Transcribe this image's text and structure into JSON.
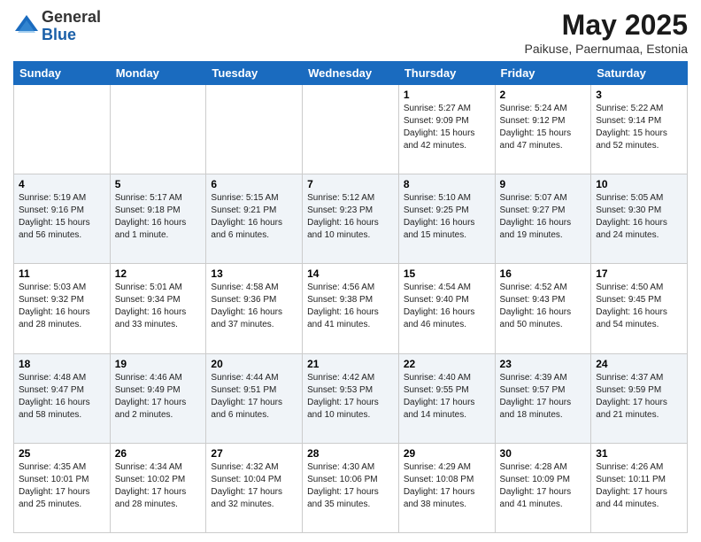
{
  "logo": {
    "general": "General",
    "blue": "Blue"
  },
  "title": "May 2025",
  "subtitle": "Paikuse, Paernumaa, Estonia",
  "days_header": [
    "Sunday",
    "Monday",
    "Tuesday",
    "Wednesday",
    "Thursday",
    "Friday",
    "Saturday"
  ],
  "weeks": [
    [
      {
        "day": "",
        "info": ""
      },
      {
        "day": "",
        "info": ""
      },
      {
        "day": "",
        "info": ""
      },
      {
        "day": "",
        "info": ""
      },
      {
        "day": "1",
        "info": "Sunrise: 5:27 AM\nSunset: 9:09 PM\nDaylight: 15 hours\nand 42 minutes."
      },
      {
        "day": "2",
        "info": "Sunrise: 5:24 AM\nSunset: 9:12 PM\nDaylight: 15 hours\nand 47 minutes."
      },
      {
        "day": "3",
        "info": "Sunrise: 5:22 AM\nSunset: 9:14 PM\nDaylight: 15 hours\nand 52 minutes."
      }
    ],
    [
      {
        "day": "4",
        "info": "Sunrise: 5:19 AM\nSunset: 9:16 PM\nDaylight: 15 hours\nand 56 minutes."
      },
      {
        "day": "5",
        "info": "Sunrise: 5:17 AM\nSunset: 9:18 PM\nDaylight: 16 hours\nand 1 minute."
      },
      {
        "day": "6",
        "info": "Sunrise: 5:15 AM\nSunset: 9:21 PM\nDaylight: 16 hours\nand 6 minutes."
      },
      {
        "day": "7",
        "info": "Sunrise: 5:12 AM\nSunset: 9:23 PM\nDaylight: 16 hours\nand 10 minutes."
      },
      {
        "day": "8",
        "info": "Sunrise: 5:10 AM\nSunset: 9:25 PM\nDaylight: 16 hours\nand 15 minutes."
      },
      {
        "day": "9",
        "info": "Sunrise: 5:07 AM\nSunset: 9:27 PM\nDaylight: 16 hours\nand 19 minutes."
      },
      {
        "day": "10",
        "info": "Sunrise: 5:05 AM\nSunset: 9:30 PM\nDaylight: 16 hours\nand 24 minutes."
      }
    ],
    [
      {
        "day": "11",
        "info": "Sunrise: 5:03 AM\nSunset: 9:32 PM\nDaylight: 16 hours\nand 28 minutes."
      },
      {
        "day": "12",
        "info": "Sunrise: 5:01 AM\nSunset: 9:34 PM\nDaylight: 16 hours\nand 33 minutes."
      },
      {
        "day": "13",
        "info": "Sunrise: 4:58 AM\nSunset: 9:36 PM\nDaylight: 16 hours\nand 37 minutes."
      },
      {
        "day": "14",
        "info": "Sunrise: 4:56 AM\nSunset: 9:38 PM\nDaylight: 16 hours\nand 41 minutes."
      },
      {
        "day": "15",
        "info": "Sunrise: 4:54 AM\nSunset: 9:40 PM\nDaylight: 16 hours\nand 46 minutes."
      },
      {
        "day": "16",
        "info": "Sunrise: 4:52 AM\nSunset: 9:43 PM\nDaylight: 16 hours\nand 50 minutes."
      },
      {
        "day": "17",
        "info": "Sunrise: 4:50 AM\nSunset: 9:45 PM\nDaylight: 16 hours\nand 54 minutes."
      }
    ],
    [
      {
        "day": "18",
        "info": "Sunrise: 4:48 AM\nSunset: 9:47 PM\nDaylight: 16 hours\nand 58 minutes."
      },
      {
        "day": "19",
        "info": "Sunrise: 4:46 AM\nSunset: 9:49 PM\nDaylight: 17 hours\nand 2 minutes."
      },
      {
        "day": "20",
        "info": "Sunrise: 4:44 AM\nSunset: 9:51 PM\nDaylight: 17 hours\nand 6 minutes."
      },
      {
        "day": "21",
        "info": "Sunrise: 4:42 AM\nSunset: 9:53 PM\nDaylight: 17 hours\nand 10 minutes."
      },
      {
        "day": "22",
        "info": "Sunrise: 4:40 AM\nSunset: 9:55 PM\nDaylight: 17 hours\nand 14 minutes."
      },
      {
        "day": "23",
        "info": "Sunrise: 4:39 AM\nSunset: 9:57 PM\nDaylight: 17 hours\nand 18 minutes."
      },
      {
        "day": "24",
        "info": "Sunrise: 4:37 AM\nSunset: 9:59 PM\nDaylight: 17 hours\nand 21 minutes."
      }
    ],
    [
      {
        "day": "25",
        "info": "Sunrise: 4:35 AM\nSunset: 10:01 PM\nDaylight: 17 hours\nand 25 minutes."
      },
      {
        "day": "26",
        "info": "Sunrise: 4:34 AM\nSunset: 10:02 PM\nDaylight: 17 hours\nand 28 minutes."
      },
      {
        "day": "27",
        "info": "Sunrise: 4:32 AM\nSunset: 10:04 PM\nDaylight: 17 hours\nand 32 minutes."
      },
      {
        "day": "28",
        "info": "Sunrise: 4:30 AM\nSunset: 10:06 PM\nDaylight: 17 hours\nand 35 minutes."
      },
      {
        "day": "29",
        "info": "Sunrise: 4:29 AM\nSunset: 10:08 PM\nDaylight: 17 hours\nand 38 minutes."
      },
      {
        "day": "30",
        "info": "Sunrise: 4:28 AM\nSunset: 10:09 PM\nDaylight: 17 hours\nand 41 minutes."
      },
      {
        "day": "31",
        "info": "Sunrise: 4:26 AM\nSunset: 10:11 PM\nDaylight: 17 hours\nand 44 minutes."
      }
    ]
  ]
}
